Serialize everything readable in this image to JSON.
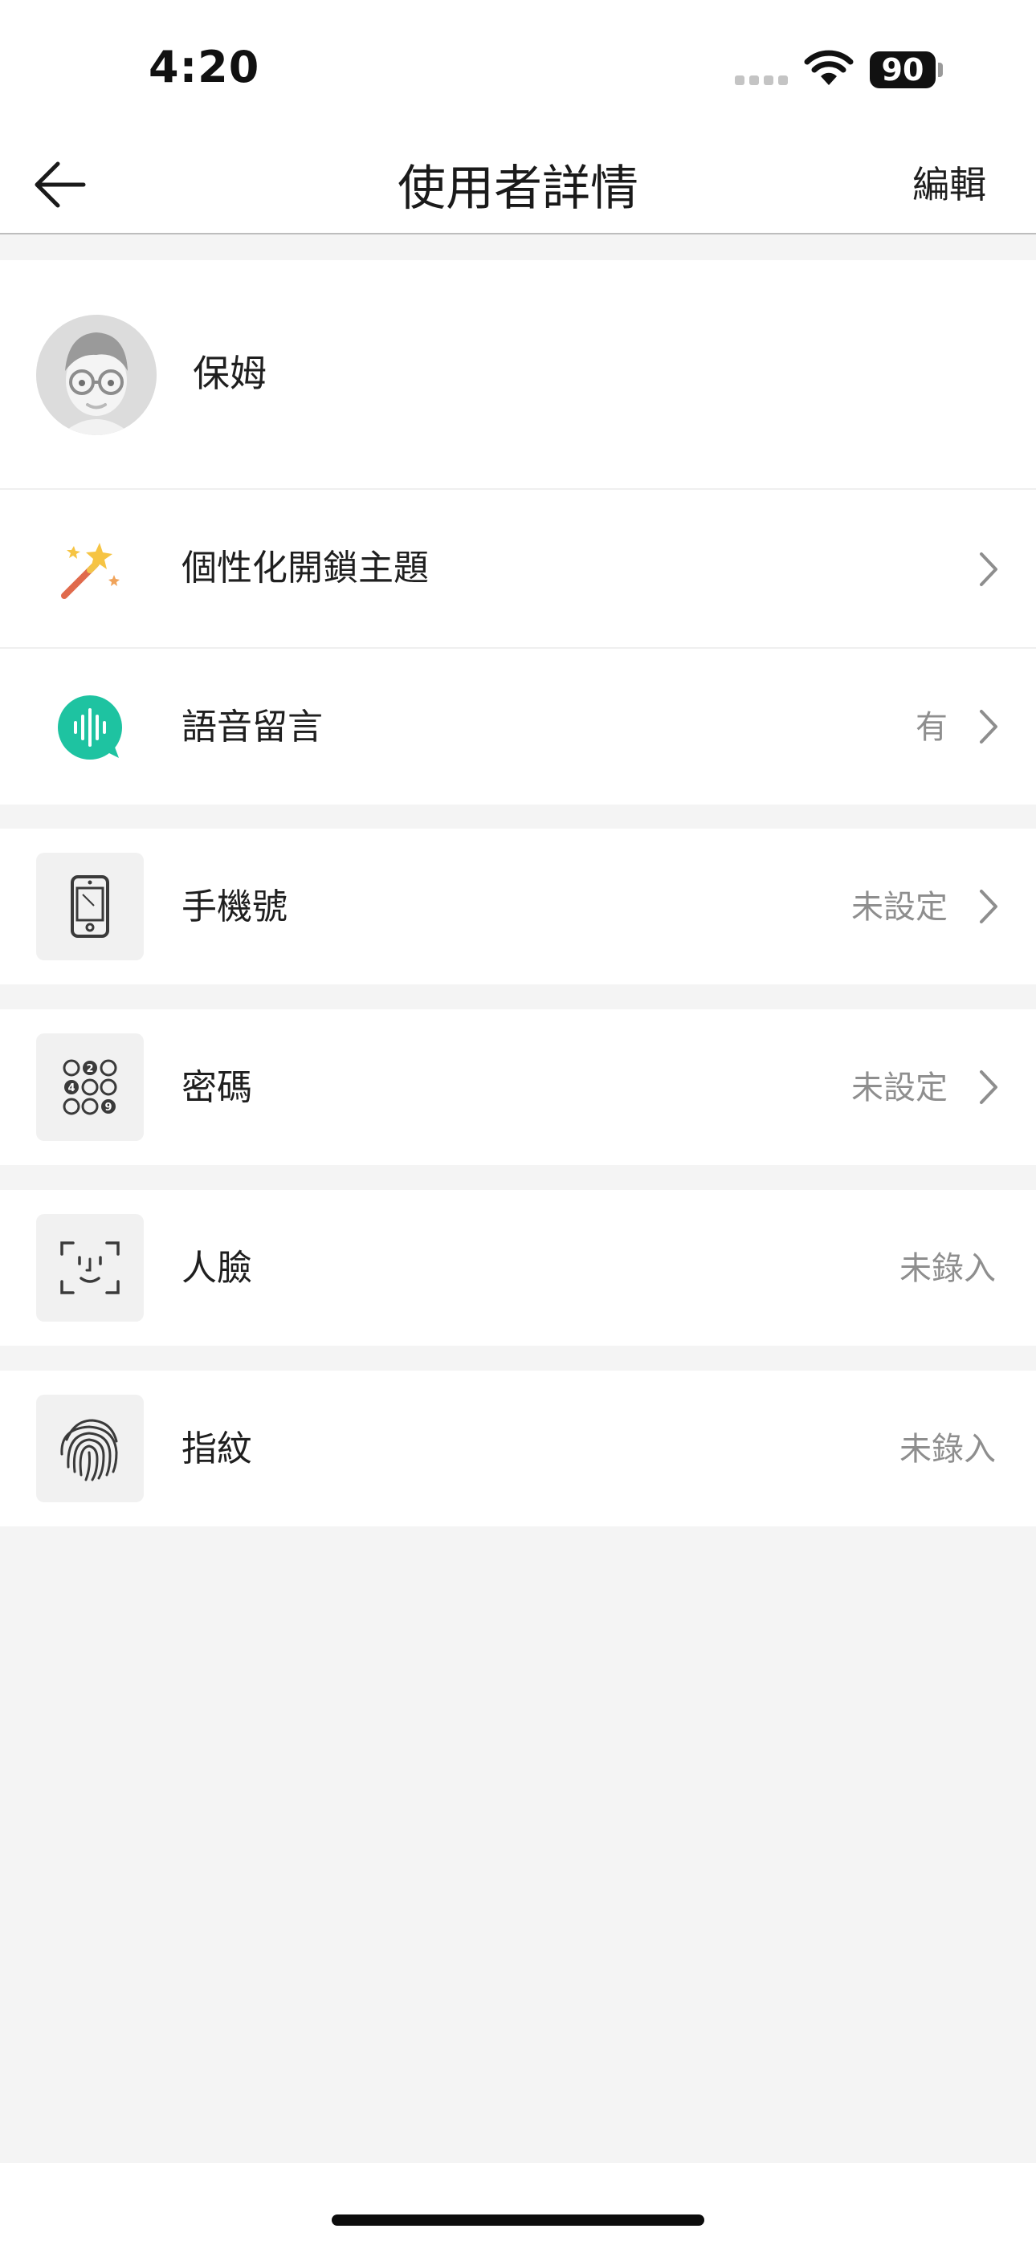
{
  "status_bar": {
    "time": "4:20",
    "battery": "90"
  },
  "header": {
    "title": "使用者詳情",
    "edit_label": "編輯",
    "back_icon": "arrow-left-icon"
  },
  "user": {
    "name": "保姆",
    "avatar_icon": "avatar-glasses-icon"
  },
  "rows": {
    "theme": {
      "label": "個性化開鎖主題",
      "value": "",
      "icon": "magic-wand-icon"
    },
    "voice": {
      "label": "語音留言",
      "value": "有",
      "icon": "voice-message-icon",
      "accent": "#1ec3a1"
    },
    "phone": {
      "label": "手機號",
      "value": "未設定",
      "icon": "phone-icon"
    },
    "password": {
      "label": "密碼",
      "value": "未設定",
      "icon": "keypad-icon",
      "keypad_digits": [
        "2",
        "4",
        "9"
      ]
    },
    "face": {
      "label": "人臉",
      "value": "未錄入",
      "icon": "face-scan-icon"
    },
    "fingerprint": {
      "label": "指紋",
      "value": "未錄入",
      "icon": "fingerprint-icon"
    }
  },
  "colors": {
    "page_background": "#f4f4f4",
    "card_background": "#ffffff",
    "secondary_text": "#8e8e8e"
  }
}
